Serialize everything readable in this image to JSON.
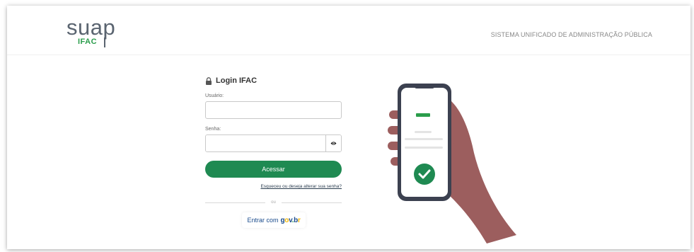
{
  "header": {
    "logo_word": "suap",
    "logo_sub": "IFAC",
    "system_title": "SISTEMA UNIFICADO DE ADMINISTRAÇÃO PÚBLICA"
  },
  "login": {
    "title": "Login IFAC",
    "username_label": "Usuário:",
    "username_value": "",
    "password_label": "Senha:",
    "password_value": "",
    "submit_label": "Acessar",
    "forgot_link": "Esqueceu ou deseja alterar sua senha?",
    "divider_text": "ou",
    "govbr_prefix": "Entrar com",
    "govbr_logo": "gov.br"
  },
  "icons": {
    "lock": "lock-icon",
    "eye": "eye-icon",
    "check": "check-icon"
  },
  "colors": {
    "primary_green": "#1f8a52",
    "logo_green": "#2a9d4b",
    "logo_gray": "#5a6470",
    "skin": "#9c5e5e",
    "govbr_blue": "#1a4b8c",
    "govbr_yellow": "#f2b705"
  }
}
